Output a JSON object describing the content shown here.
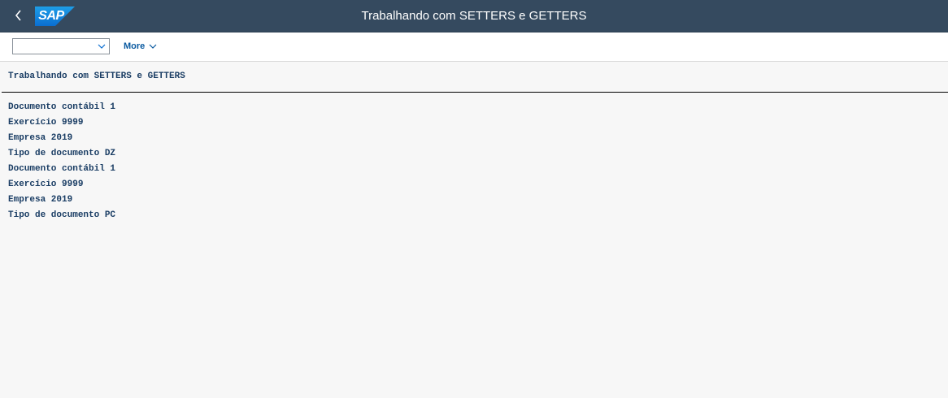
{
  "shell": {
    "logo_text": "SAP",
    "title": "Trabalhando com SETTERS e GETTERS",
    "back_icon": "chevron-left-icon",
    "colors": {
      "shell_bg": "#354a5f",
      "logo_blue": "#0a6ed1",
      "text_blue": "#1a3d64"
    }
  },
  "toolbar": {
    "dropdown_value": "",
    "more_label": "More"
  },
  "report": {
    "heading": "Trabalhando com SETTERS e GETTERS",
    "lines": [
      "Documento contábil 1",
      "Exercício 9999",
      "Empresa 2019",
      "Tipo de documento DZ",
      "Documento contábil 1",
      "Exercício 9999",
      "Empresa 2019",
      "Tipo de documento PC"
    ]
  }
}
